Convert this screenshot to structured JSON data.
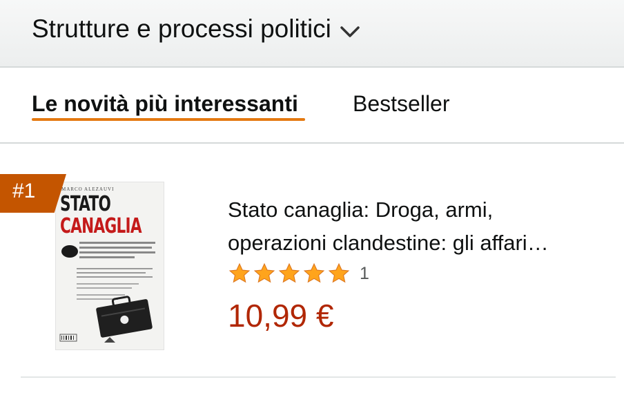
{
  "header": {
    "category_label": "Strutture e processi politici",
    "chevron_icon": "chevron-down-icon"
  },
  "tabs": [
    {
      "label": "Le novità più interessanti",
      "active": true
    },
    {
      "label": "Bestseller",
      "active": false
    }
  ],
  "colors": {
    "accent_underline": "#e47911",
    "rank_badge": "#c45500",
    "price": "#b12704",
    "star": "#ffa41c"
  },
  "item": {
    "rank": "#1",
    "title_line1": "Stato canaglia: Droga, armi,",
    "title_line2": "operazioni clandestine: gli affari…",
    "rating": 5,
    "rating_max": 5,
    "rating_count": "1",
    "price": "10,99 €",
    "cover": {
      "title_line1": "STATO",
      "title_line2": "CANAGLIA"
    }
  }
}
